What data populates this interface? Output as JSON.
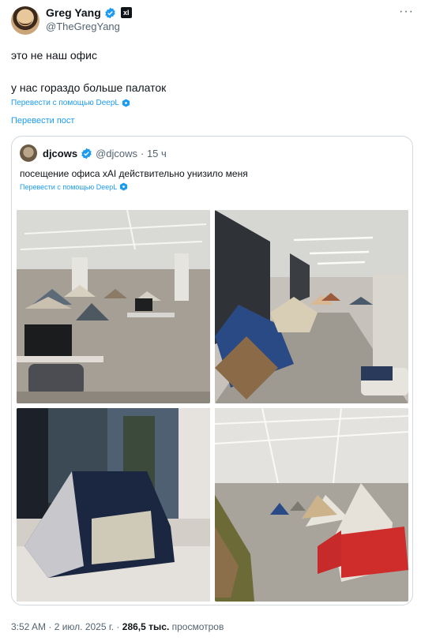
{
  "author": {
    "name": "Greg Yang",
    "handle": "@TheGregYang",
    "badge": "xI"
  },
  "tweet": {
    "line1": "это не наш офис",
    "line2": "у нас гораздо больше палаток",
    "deepl_label": "Перевести с помощью DeepL",
    "translate_label": "Перевести пост"
  },
  "quote": {
    "name": "djcows",
    "handle": "@djcows",
    "time": "· 15 ч",
    "text": "посещение офиса xAI действительно унизило меня",
    "deepl_label": "Перевести с помощью DeepL"
  },
  "footer": {
    "time": "3:52 AM",
    "date": "· 2 июл. 2025 г. ·",
    "views": "286,5 тыс.",
    "views_label": "просмотров"
  },
  "colors": {
    "link": "#1d9bf0",
    "muted": "#536471",
    "text": "#0f1419",
    "border": "#cfd9de"
  },
  "icons": [
    "verified-badge-icon",
    "more-icon",
    "deepl-icon"
  ]
}
